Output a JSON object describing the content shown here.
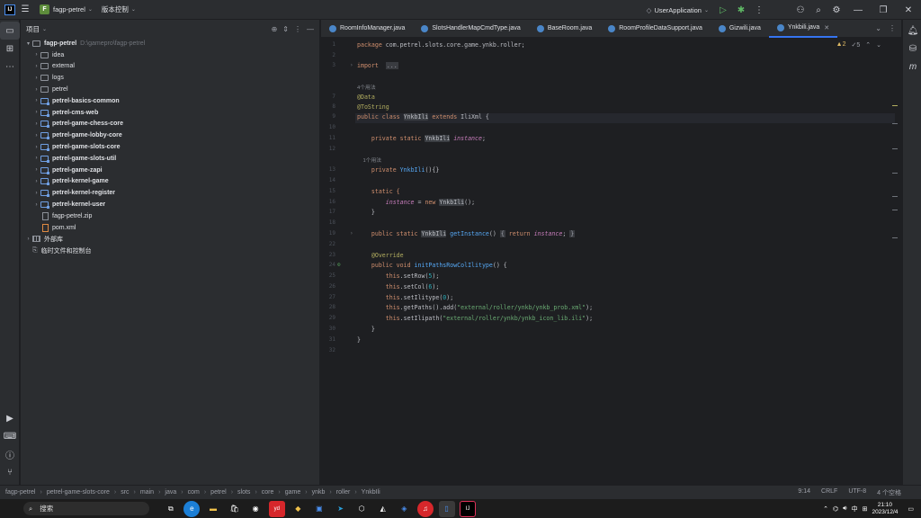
{
  "titlebar": {
    "project_badge": "F",
    "project_name": "fagp-petrel",
    "vcs_label": "版本控制",
    "run_config": "UserApplication"
  },
  "project_panel": {
    "title": "项目",
    "root_name": "fagp-petrel",
    "root_path": "D:\\gamepro\\fagp-petrel",
    "items": [
      {
        "label": "idea",
        "type": "folder",
        "mod": false
      },
      {
        "label": "external",
        "type": "folder",
        "mod": false
      },
      {
        "label": "logs",
        "type": "folder",
        "mod": false
      },
      {
        "label": "petrel",
        "type": "folder",
        "mod": false
      },
      {
        "label": "petrel-basics-common",
        "type": "folder",
        "mod": true
      },
      {
        "label": "petrel-cms-web",
        "type": "folder",
        "mod": true
      },
      {
        "label": "petrel-game-chess-core",
        "type": "folder",
        "mod": true
      },
      {
        "label": "petrel-game-lobby-core",
        "type": "folder",
        "mod": true
      },
      {
        "label": "petrel-game-slots-core",
        "type": "folder",
        "mod": true
      },
      {
        "label": "petrel-game-slots-util",
        "type": "folder",
        "mod": true
      },
      {
        "label": "petrel-game-zapi",
        "type": "folder",
        "mod": true
      },
      {
        "label": "petrel-kernel-game",
        "type": "folder",
        "mod": true
      },
      {
        "label": "petrel-kernel-register",
        "type": "folder",
        "mod": true
      },
      {
        "label": "petrel-kernel-user",
        "type": "folder",
        "mod": true
      },
      {
        "label": "fagp-petrel.zip",
        "type": "file",
        "mod": false
      },
      {
        "label": "pom.xml",
        "type": "xml",
        "mod": false
      }
    ],
    "external_libs": "外部库",
    "scratches": "临时文件和控制台"
  },
  "tabs": [
    {
      "label": "RoomInfoManager.java",
      "active": false
    },
    {
      "label": "SlotsHandlerMapCmdType.java",
      "active": false
    },
    {
      "label": "BaseRoom.java",
      "active": false
    },
    {
      "label": "RoomProfileDataSupport.java",
      "active": false
    },
    {
      "label": "Gizwili.java",
      "active": false
    },
    {
      "label": "Ynkbili.java",
      "active": true
    }
  ],
  "inspections": {
    "warnings": "2",
    "weak": "5"
  },
  "code": {
    "l1_kw": "package",
    "l1_rest": " com.petrel.slots.core.game.ynkb.roller;",
    "l3_kw": "import",
    "l3_fold": "...",
    "hint_usage_4": "4个用法",
    "l7_ann": "@Data",
    "l8_ann": "@ToString",
    "l9_kw": "public class ",
    "l9_cls": "YnkbIli",
    "l9_kw2": " extends ",
    "l9_rest": "IliXml {",
    "l11_kw": "private static ",
    "l11_cls": "YnkbIli",
    "l11_fld": " instance",
    "l11_end": ";",
    "hint_usage_1": "1个用法",
    "l13_kw": "private ",
    "l13_fn": "YnkbIli",
    "l13_end": "(){}",
    "l15": "static {",
    "l16_fld": "instance",
    "l16_eq": " = ",
    "l16_kw": "new ",
    "l16_cls": "YnkbIli",
    "l16_end": "();",
    "l17": "}",
    "l19_kw": "public static ",
    "l19_cls": "YnkbIli",
    "l19_fn": " getInstance",
    "l19_paren": "() ",
    "l19_open": "{",
    "l19_ret": " return ",
    "l19_fld": "instance",
    "l19_semi": "; ",
    "l19_close": "}",
    "l23_ann": "@Override",
    "l24_kw": "public void ",
    "l24_fn": "initPathsRowColIlitype",
    "l24_end": "() {",
    "l25_this": "this",
    "l25_rest": ".setRow(",
    "l25_num": "5",
    "l25_end": ");",
    "l26_this": "this",
    "l26_rest": ".setCol(",
    "l26_num": "6",
    "l26_end": ");",
    "l27_this": "this",
    "l27_rest": ".setIlitype(",
    "l27_num": "0",
    "l27_end": ");",
    "l28_this": "this",
    "l28_rest": ".getPaths().add(",
    "l28_str": "\"external/roller/ynkb/ynkb_prob.xml\"",
    "l28_end": ");",
    "l29_this": "this",
    "l29_rest": ".setIlipath(",
    "l29_str": "\"external/roller/ynkb/ynkb_icon_lib.ili\"",
    "l29_end": ");",
    "l30": "}",
    "l31": "}"
  },
  "line_numbers": [
    "1",
    "2",
    "3",
    "6",
    "7",
    "8",
    "9",
    "10",
    "11",
    "12",
    "13",
    "14",
    "15",
    "16",
    "17",
    "18",
    "19",
    "22",
    "23",
    "24",
    "25",
    "26",
    "27",
    "28",
    "29",
    "30",
    "31",
    "32"
  ],
  "statusbar": {
    "breadcrumbs": [
      "fagp-petrel",
      "petrel-game-slots-core",
      "src",
      "main",
      "java",
      "com",
      "petrel",
      "slots",
      "core",
      "game",
      "ynkb",
      "roller",
      "YnkbIli"
    ],
    "position": "9:14",
    "line_sep": "CRLF",
    "encoding": "UTF-8",
    "indent": "4 个空格"
  },
  "taskbar": {
    "search": "搜索",
    "lang": "中",
    "time": "21:10",
    "date": "2023/12/4"
  }
}
